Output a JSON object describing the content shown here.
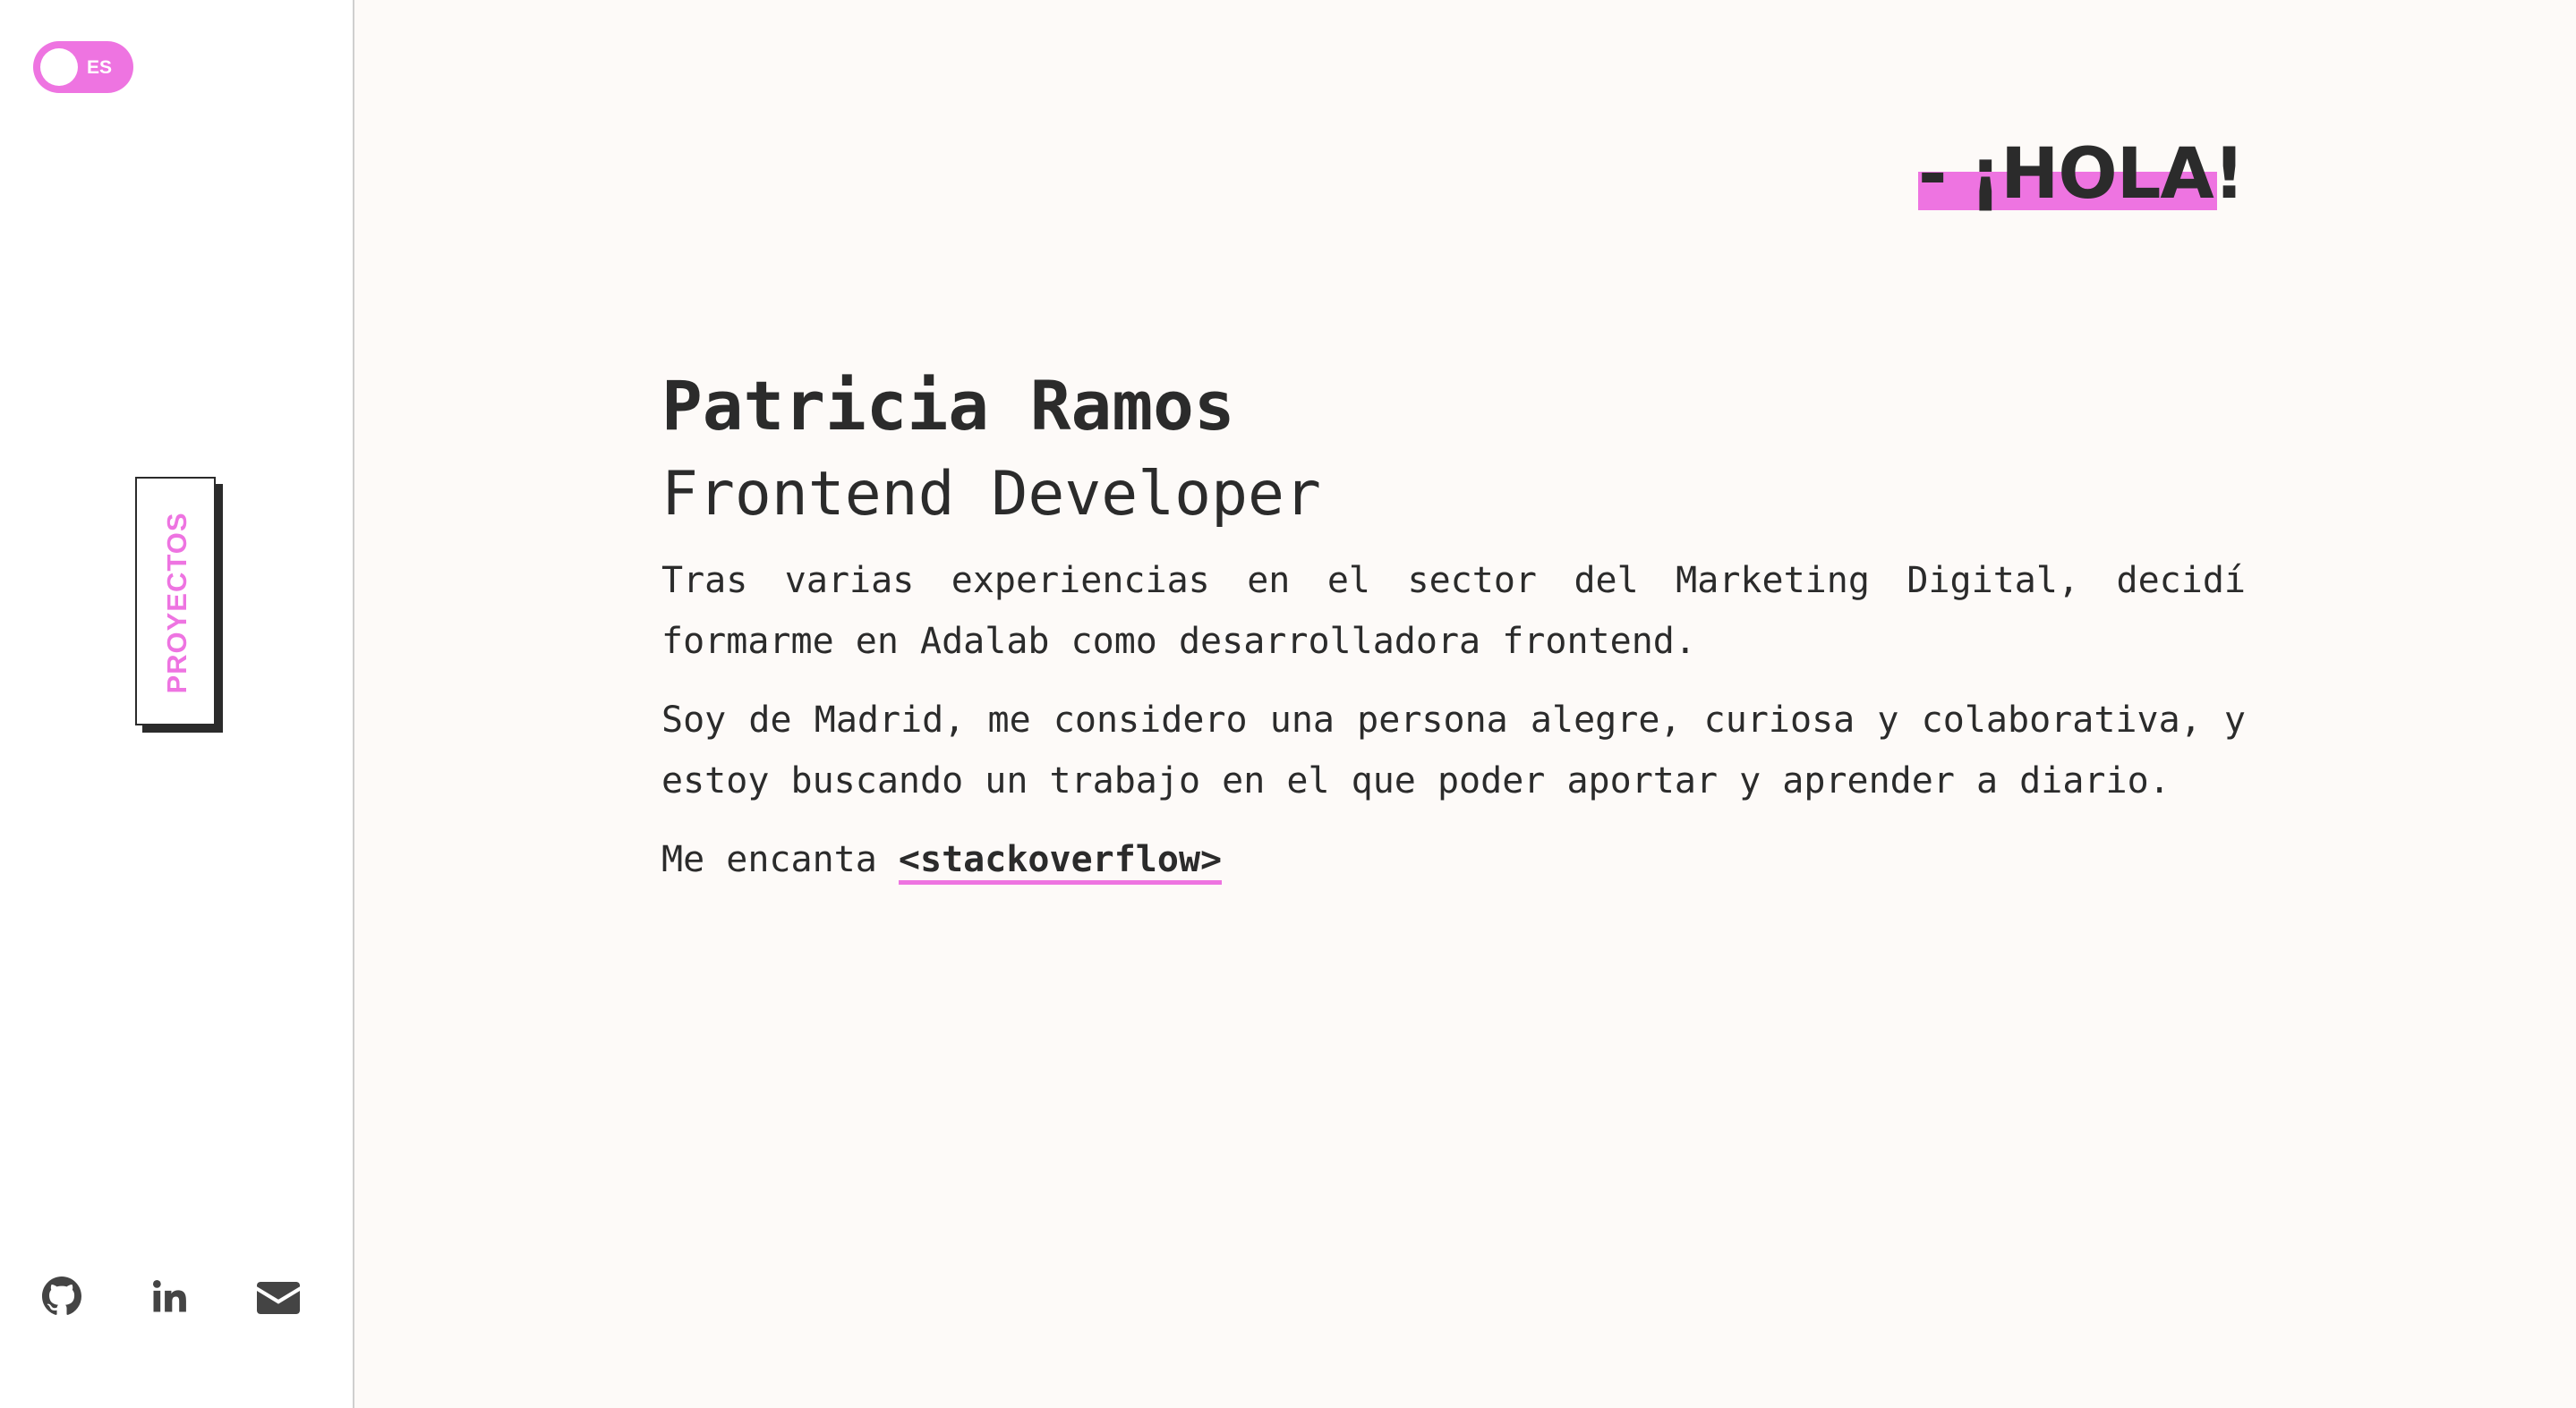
{
  "colors": {
    "accent": "#ee74e1",
    "text": "#2b2b2b",
    "background": "#fdfaf8",
    "sidebar_background": "#ffffff"
  },
  "sidebar": {
    "language_toggle": {
      "label": "ES"
    },
    "projects_button": {
      "label": "PROYECTOS"
    },
    "social_links": [
      {
        "icon": "github-icon"
      },
      {
        "icon": "linkedin-icon"
      },
      {
        "icon": "envelope-icon"
      }
    ]
  },
  "main": {
    "greeting": "- ¡HOLA!",
    "name": "Patricia Ramos",
    "role": "Frontend Developer",
    "paragraph_1": "Tras varias experiencias en el sector del Marketing Digital, decidí formarme en Adalab como desarrolladora frontend.",
    "paragraph_2": "Soy de Madrid, me considero una persona alegre, curiosa y colaborativa, y estoy buscando un trabajo en el que poder aportar y aprender a diario.",
    "paragraph_3_prefix": "Me encanta ",
    "paragraph_3_link": "<stackoverflow>"
  }
}
